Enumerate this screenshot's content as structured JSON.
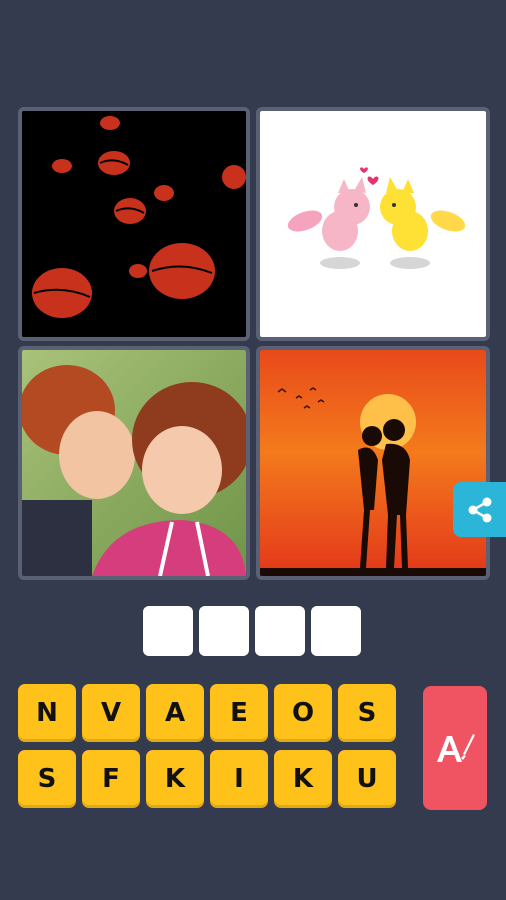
{
  "answer_slots": [
    "",
    "",
    "",
    ""
  ],
  "letters_row1": [
    "N",
    "V",
    "A",
    "E",
    "O",
    "S"
  ],
  "letters_row2": [
    "S",
    "F",
    "K",
    "I",
    "K",
    "U"
  ],
  "colors": {
    "background": "#353b4f",
    "tile_border": "#5a6174",
    "key": "#ffc21a",
    "hint_button": "#f05361",
    "share_button": "#2bb5d8"
  }
}
